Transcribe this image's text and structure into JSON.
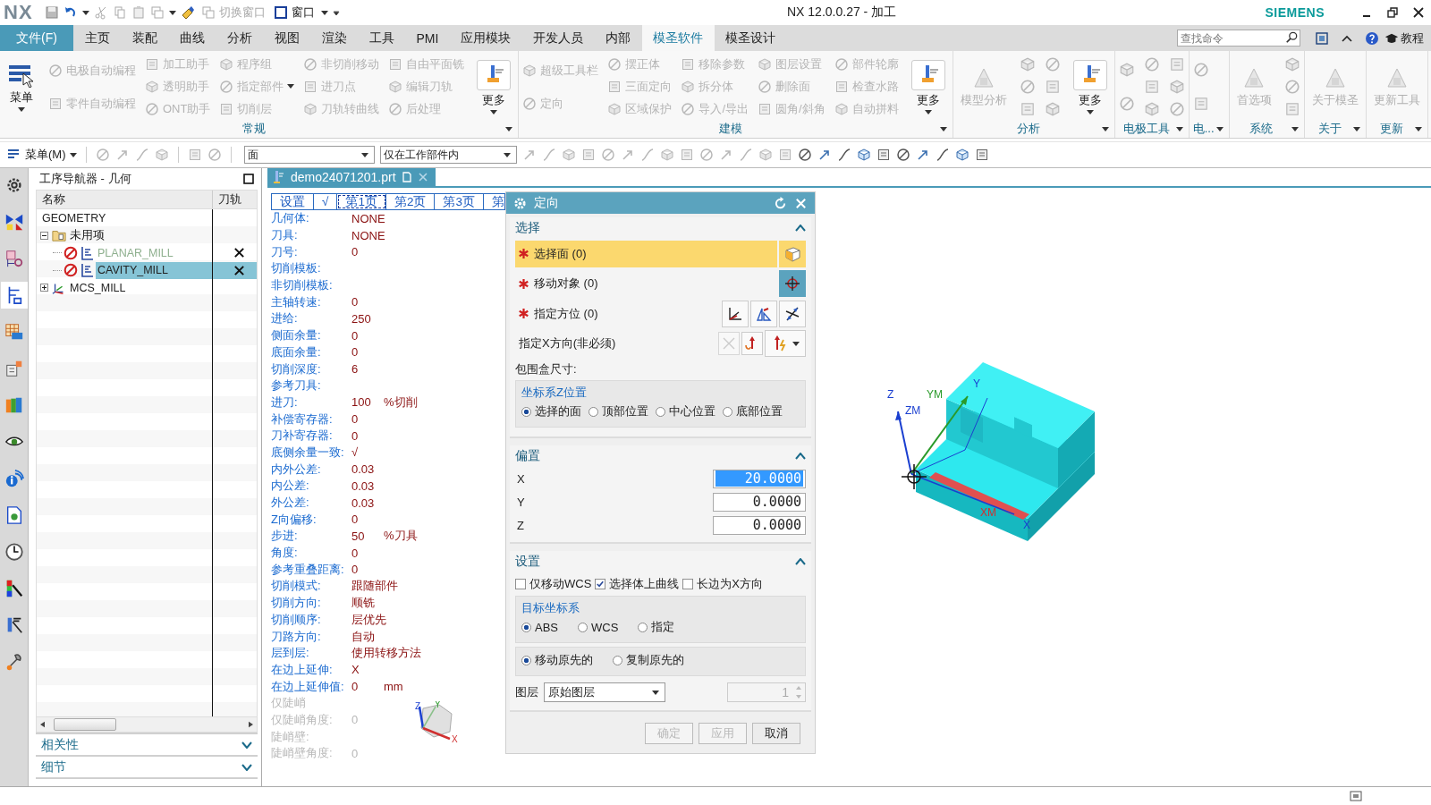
{
  "title_bar": {
    "app_logo": "NX",
    "title": "NX 12.0.0.27 - 加工",
    "brand": "SIEMENS",
    "quick_access": [
      {
        "label": "切换窗口",
        "disabled": true
      },
      {
        "label": "窗口",
        "disabled": false
      }
    ]
  },
  "menu_tabs": {
    "file_button": "文件(F)",
    "tabs": [
      {
        "label": "主页",
        "selected": false
      },
      {
        "label": "装配",
        "selected": false
      },
      {
        "label": "曲线",
        "selected": false
      },
      {
        "label": "分析",
        "selected": false
      },
      {
        "label": "视图",
        "selected": false
      },
      {
        "label": "渲染",
        "selected": false
      },
      {
        "label": "工具",
        "selected": false
      },
      {
        "label": "PMI",
        "selected": false
      },
      {
        "label": "应用模块",
        "selected": false
      },
      {
        "label": "开发人员",
        "selected": false
      },
      {
        "label": "内部",
        "selected": false
      },
      {
        "label": "模圣软件",
        "selected": true
      },
      {
        "label": "模圣设计",
        "selected": false
      }
    ],
    "search": {
      "placeholder": "查找命令"
    },
    "help_label": "教程"
  },
  "ribbon": {
    "groups": [
      {
        "label": "常规",
        "columns": [
          [
            {
              "kind": "large",
              "label": "菜单",
              "disabled": false,
              "menu": true
            }
          ],
          [
            {
              "kind": "small",
              "label": "电极自动编程",
              "disabled": true
            },
            {
              "kind": "small",
              "label": "零件自动编程",
              "disabled": true
            }
          ],
          [
            {
              "kind": "small",
              "label": "加工助手",
              "disabled": true
            },
            {
              "kind": "small",
              "label": "透明助手",
              "disabled": true
            },
            {
              "kind": "small",
              "label": "ONT助手",
              "disabled": true
            }
          ],
          [
            {
              "kind": "small",
              "label": "程序组",
              "disabled": true
            },
            {
              "kind": "small",
              "label": "指定部件",
              "disabled": true,
              "menu": true
            },
            {
              "kind": "small",
              "label": "切削层",
              "disabled": true
            }
          ],
          [
            {
              "kind": "small",
              "label": "非切削移动",
              "disabled": true
            },
            {
              "kind": "small",
              "label": "进刀点",
              "disabled": true
            },
            {
              "kind": "small",
              "label": "刀轨转曲线",
              "disabled": true
            }
          ],
          [
            {
              "kind": "small",
              "label": "自由平面铣",
              "disabled": true
            },
            {
              "kind": "small",
              "label": "编辑刀轨",
              "disabled": true
            },
            {
              "kind": "small",
              "label": "后处理",
              "disabled": true
            }
          ],
          [
            {
              "kind": "large",
              "label": "更多",
              "disabled": false,
              "menu": true
            }
          ]
        ]
      },
      {
        "label": "建模",
        "columns": [
          [
            {
              "kind": "small",
              "label": "超级工具栏",
              "disabled": true
            },
            {
              "kind": "small",
              "label": "定向",
              "disabled": true
            }
          ],
          [
            {
              "kind": "small",
              "label": "摆正体",
              "disabled": true
            },
            {
              "kind": "small",
              "label": "三面定向",
              "disabled": true
            },
            {
              "kind": "small",
              "label": "区域保护",
              "disabled": true
            }
          ],
          [
            {
              "kind": "small",
              "label": "移除参数",
              "disabled": true
            },
            {
              "kind": "small",
              "label": "拆分体",
              "disabled": true
            },
            {
              "kind": "small",
              "label": "导入/导出",
              "disabled": true
            }
          ],
          [
            {
              "kind": "small",
              "label": "图层设置",
              "disabled": true
            },
            {
              "kind": "small",
              "label": "删除面",
              "disabled": true
            },
            {
              "kind": "small",
              "label": "圆角/斜角",
              "disabled": true
            }
          ],
          [
            {
              "kind": "small",
              "label": "部件轮廓",
              "disabled": true
            },
            {
              "kind": "small",
              "label": "检查水路",
              "disabled": true
            },
            {
              "kind": "small",
              "label": "自动拼料",
              "disabled": true
            }
          ],
          [
            {
              "kind": "large",
              "label": "更多",
              "disabled": false,
              "menu": true
            }
          ]
        ]
      },
      {
        "label": "分析",
        "columns": [
          [
            {
              "kind": "large",
              "label": "模型分析",
              "disabled": true
            }
          ],
          [
            {
              "kind": "icon",
              "disabled": true
            },
            {
              "kind": "icon",
              "disabled": true
            },
            {
              "kind": "icon",
              "disabled": true
            }
          ],
          [
            {
              "kind": "icon",
              "disabled": true
            },
            {
              "kind": "icon",
              "disabled": true
            },
            {
              "kind": "icon",
              "disabled": true
            }
          ],
          [
            {
              "kind": "large",
              "label": "更多",
              "disabled": false,
              "menu": true
            }
          ]
        ]
      },
      {
        "label": "电极工具",
        "columns": [
          [
            {
              "kind": "icon",
              "disabled": true
            },
            {
              "kind": "icon",
              "disabled": true
            }
          ],
          [
            {
              "kind": "icon",
              "disabled": true
            },
            {
              "kind": "icon",
              "disabled": true
            },
            {
              "kind": "icon",
              "disabled": true
            }
          ],
          [
            {
              "kind": "icon",
              "disabled": true
            },
            {
              "kind": "icon",
              "disabled": true
            },
            {
              "kind": "icon",
              "disabled": true
            }
          ]
        ]
      },
      {
        "label": "电...",
        "columns": [
          [
            {
              "kind": "icon",
              "disabled": true
            },
            {
              "kind": "icon",
              "disabled": true
            }
          ]
        ]
      },
      {
        "label": "系统",
        "columns": [
          [
            {
              "kind": "large",
              "label": "首选项",
              "disabled": true
            }
          ],
          [
            {
              "kind": "icon",
              "disabled": true
            },
            {
              "kind": "icon",
              "disabled": true
            },
            {
              "kind": "icon",
              "disabled": true
            }
          ]
        ]
      },
      {
        "label": "关于",
        "columns": [
          [
            {
              "kind": "large",
              "label": "关于模圣",
              "disabled": true
            }
          ]
        ]
      },
      {
        "label": "更新",
        "columns": [
          [
            {
              "kind": "large",
              "label": "更新工具",
              "disabled": true
            }
          ]
        ]
      }
    ]
  },
  "toolbar": {
    "menu_button": "菜单(M)",
    "filters": [
      {
        "value": "面"
      },
      {
        "value": "仅在工作部件内"
      }
    ]
  },
  "navigator": {
    "title": "工序导航器 - 几何",
    "columns": [
      "名称",
      "刀轨"
    ],
    "tree": [
      {
        "label": "GEOMETRY",
        "kind": "root",
        "selected": false
      },
      {
        "label": "未用项",
        "kind": "folder",
        "expanded": true,
        "selected": false,
        "children": [
          {
            "label": "PLANAR_MILL",
            "kind": "operation",
            "selected": false,
            "inactive": true,
            "toolpath_missing": true
          },
          {
            "label": "CAVITY_MILL",
            "kind": "operation",
            "selected": true,
            "inactive": false,
            "toolpath_missing": true
          }
        ]
      },
      {
        "label": "MCS_MILL",
        "kind": "mcs",
        "expanded": false,
        "selected": false
      }
    ],
    "panels": [
      {
        "label": "相关性",
        "expanded": false
      },
      {
        "label": "细节",
        "expanded": false
      }
    ]
  },
  "document_tab": {
    "label": "demo24071201.prt"
  },
  "parameters": {
    "tabs": [
      {
        "label": "设置",
        "selected": false
      },
      {
        "label": "√",
        "selected": false
      },
      {
        "label": "第1页",
        "selected": true
      },
      {
        "label": "第2页",
        "selected": false
      },
      {
        "label": "第3页",
        "selected": false
      },
      {
        "label": "第",
        "selected": false
      }
    ],
    "rows": [
      {
        "label": "几何体:",
        "value": "NONE",
        "disabled": false
      },
      {
        "label": "刀具:",
        "value": "NONE",
        "disabled": false
      },
      {
        "label": "刀号:",
        "value": "0",
        "disabled": false
      },
      {
        "label": "切削模板:",
        "disabled": false
      },
      {
        "label": "非切削模板:",
        "disabled": false
      },
      {
        "label": "主轴转速:",
        "value": "0",
        "disabled": false
      },
      {
        "label": "进给:",
        "value": "250",
        "disabled": false
      },
      {
        "label": "侧面余量:",
        "value": "0",
        "disabled": false
      },
      {
        "label": "底面余量:",
        "value": "0",
        "disabled": false
      },
      {
        "label": "切削深度:",
        "value": "6",
        "disabled": false
      },
      {
        "label": "参考刀具:",
        "disabled": false
      },
      {
        "label": "进刀:",
        "value": "100",
        "unit": "%切削",
        "disabled": false
      },
      {
        "label": "补偿寄存器:",
        "value": "0",
        "disabled": false
      },
      {
        "label": "刀补寄存器:",
        "value": "0",
        "disabled": false
      },
      {
        "label": "底侧余量一致:",
        "value": "√",
        "disabled": false
      },
      {
        "label": "内外公差:",
        "value": "0.03",
        "disabled": false
      },
      {
        "label": "内公差:",
        "value": "0.03",
        "disabled": false
      },
      {
        "label": "外公差:",
        "value": "0.03",
        "disabled": false
      },
      {
        "label": "Z向偏移:",
        "value": "0",
        "disabled": false
      },
      {
        "label": "步进:",
        "value": "50",
        "unit": "%刀具",
        "disabled": false
      },
      {
        "label": "角度:",
        "value": "0",
        "disabled": false
      },
      {
        "label": "参考重叠距离:",
        "value": "0",
        "disabled": false
      },
      {
        "label": "切削模式:",
        "value": "跟随部件",
        "disabled": false
      },
      {
        "label": "切削方向:",
        "value": "顺铣",
        "disabled": false
      },
      {
        "label": "切削顺序:",
        "value": "层优先",
        "disabled": false
      },
      {
        "label": "刀路方向:",
        "value": "自动",
        "disabled": false
      },
      {
        "label": "层到层:",
        "value": "使用转移方法",
        "disabled": false
      },
      {
        "label": "在边上延伸:",
        "value": "X",
        "disabled": false
      },
      {
        "label": "在边上延伸值:",
        "value": "0",
        "unit": "mm",
        "disabled": false
      },
      {
        "label": "仅陡峭",
        "disabled": true
      },
      {
        "label": "仅陡峭角度:",
        "value": "0",
        "disabled": true
      },
      {
        "label": "陡峭壁:",
        "disabled": true
      },
      {
        "label": "陡峭壁角度:",
        "value": "0",
        "disabled": true
      }
    ],
    "triad_labels": [
      "Z",
      "Y",
      "X"
    ]
  },
  "dialog": {
    "title": "定向",
    "select_section": {
      "title": "选择",
      "expanded": true,
      "rows": [
        {
          "kind": "face",
          "label": "选择面 (0)",
          "required": true,
          "selected": true
        },
        {
          "kind": "object",
          "label": "移动对象 (0)",
          "required": true,
          "selected": false
        },
        {
          "kind": "orient",
          "label": "指定方位 (0)",
          "required": true,
          "selected": false
        },
        {
          "kind": "xdir",
          "label": "指定X方向(非必须)",
          "required": false,
          "selected": false
        }
      ],
      "bbox_label": "包围盒尺寸:",
      "z_group": {
        "title": "坐标系Z位置",
        "options": [
          {
            "label": "选择的面",
            "selected": true
          },
          {
            "label": "顶部位置",
            "selected": false
          },
          {
            "label": "中心位置",
            "selected": false
          },
          {
            "label": "底部位置",
            "selected": false
          }
        ]
      }
    },
    "offset_section": {
      "title": "偏置",
      "expanded": true,
      "fields": [
        {
          "label": "X",
          "value": "20.0000",
          "selected": true
        },
        {
          "label": "Y",
          "value": "0.0000",
          "selected": false
        },
        {
          "label": "Z",
          "value": "0.0000",
          "selected": false
        }
      ]
    },
    "settings_section": {
      "title": "设置",
      "expanded": true,
      "checkboxes": [
        {
          "label": "仅移动WCS",
          "checked": false
        },
        {
          "label": "选择体上曲线",
          "checked": true
        },
        {
          "label": "长边为X方向",
          "checked": false
        }
      ],
      "target_group": {
        "title": "目标坐标系",
        "options": [
          {
            "label": "ABS",
            "selected": true
          },
          {
            "label": "WCS",
            "selected": false
          },
          {
            "label": "指定",
            "selected": false
          }
        ]
      },
      "copy_options": [
        {
          "label": "移动原先的",
          "selected": true
        },
        {
          "label": "复制原先的",
          "selected": false
        }
      ],
      "layer": {
        "label": "图层",
        "value": "原始图层",
        "number": "1"
      }
    },
    "buttons": [
      {
        "label": "确定",
        "disabled": true
      },
      {
        "label": "应用",
        "disabled": true
      },
      {
        "label": "取消",
        "disabled": false
      }
    ]
  },
  "viewport": {
    "axis_labels": [
      "Z",
      "ZM",
      "YM",
      "Y",
      "XM",
      "X"
    ]
  }
}
